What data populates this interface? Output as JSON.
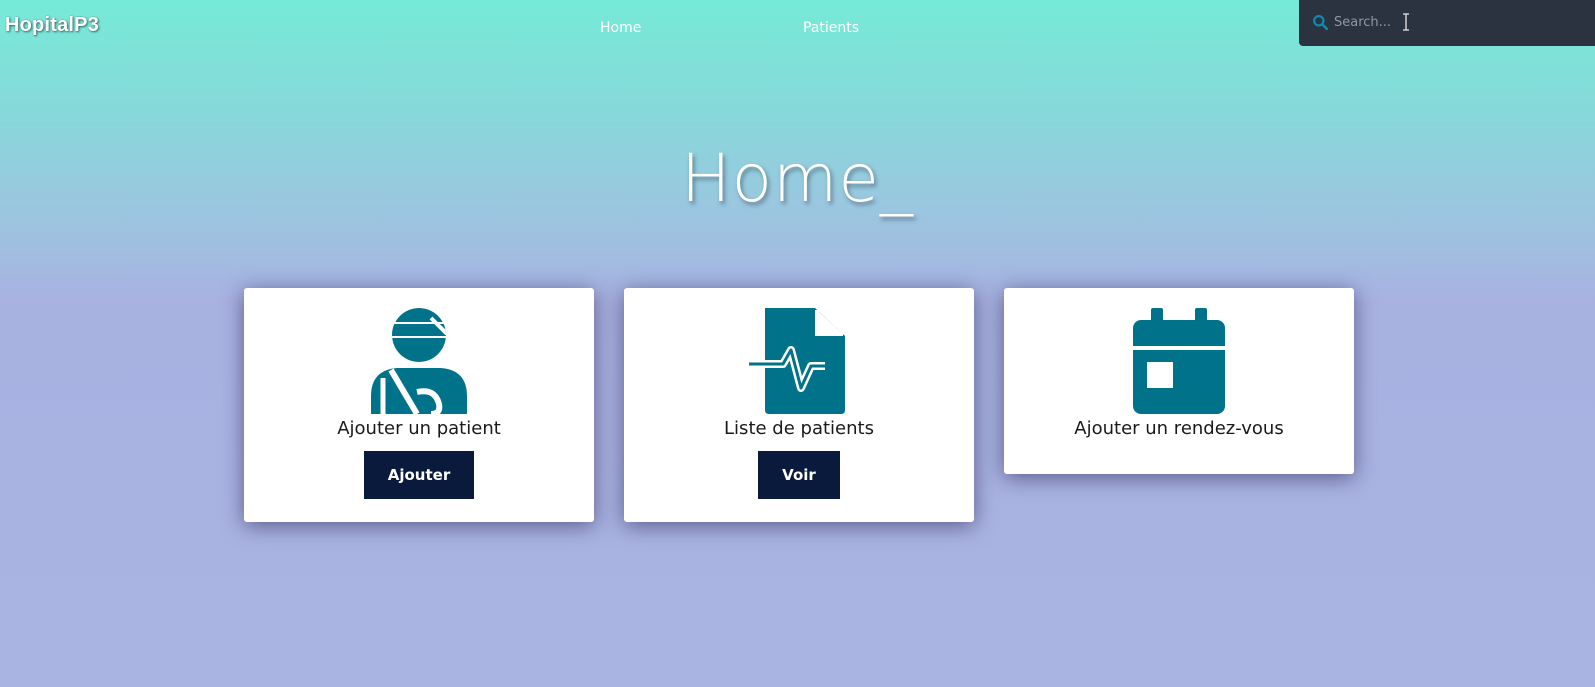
{
  "navbar": {
    "brand": "HopitalP3",
    "links": [
      {
        "label": "Home"
      },
      {
        "label": "Patients"
      }
    ],
    "search": {
      "placeholder": "Search...",
      "value": ""
    }
  },
  "main": {
    "title": "Home_",
    "cards": [
      {
        "label": "Ajouter un patient",
        "button": "Ajouter",
        "icon": "injured-person-icon"
      },
      {
        "label": "Liste de patients",
        "button": "Voir",
        "icon": "medical-file-icon"
      },
      {
        "label": "Ajouter un rendez-vous",
        "icon": "calendar-icon"
      }
    ]
  },
  "colors": {
    "accent_icon": "#00738a",
    "button_bg": "#0a1a3c",
    "gradient_top": "#76ead8",
    "gradient_bottom": "#aab4e3",
    "search_bg": "#2b3340"
  }
}
